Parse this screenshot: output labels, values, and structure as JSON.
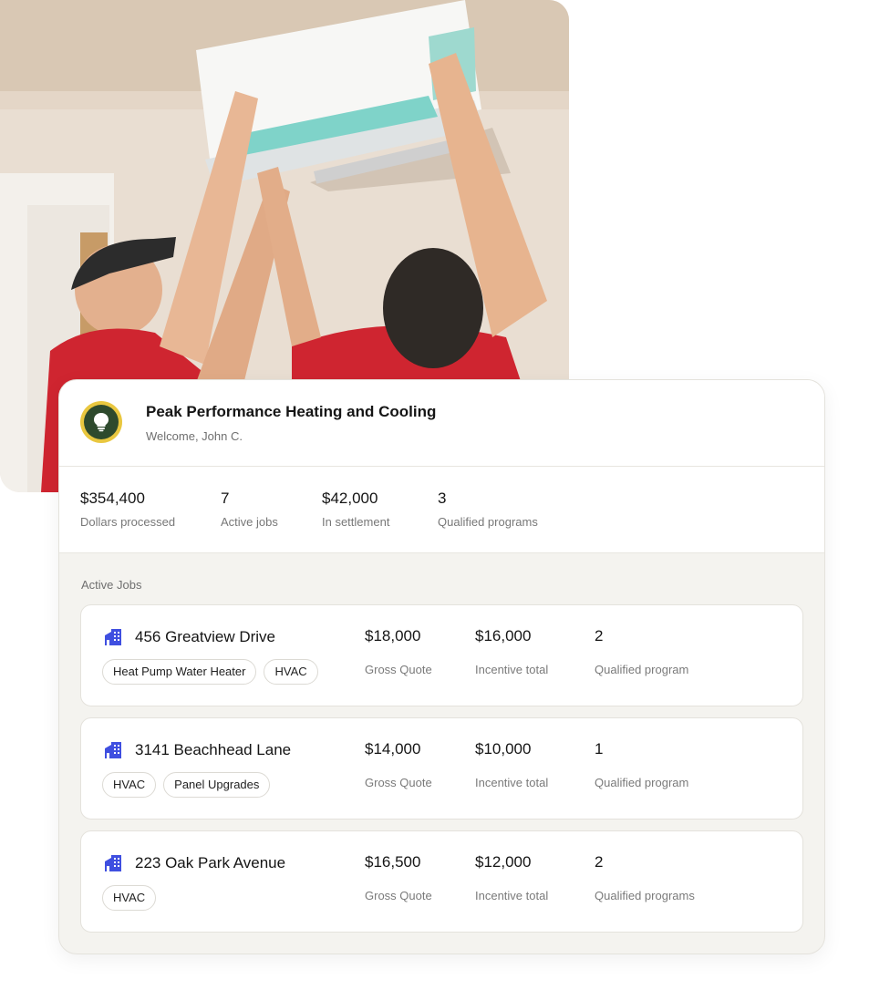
{
  "company": {
    "name": "Peak Performance Heating and Cooling",
    "welcome": "Welcome, John C.",
    "logo_icon": "lightbulb-icon"
  },
  "colors": {
    "logo_ring": "#e9c73f",
    "logo_fill": "#2e4a2d",
    "building_icon": "#3f4fe0",
    "card_background": "#f4f3ef"
  },
  "stats": [
    {
      "value": "$354,400",
      "label": "Dollars processed"
    },
    {
      "value": "7",
      "label": "Active jobs"
    },
    {
      "value": "$42,000",
      "label": "In settlement"
    },
    {
      "value": "3",
      "label": "Qualified programs"
    }
  ],
  "active_jobs": {
    "title": "Active Jobs",
    "jobs": [
      {
        "address": "456 Greatview Drive",
        "tags": [
          "Heat Pump Water Heater",
          "HVAC"
        ],
        "gross_quote": "$18,000",
        "gross_quote_label": "Gross Quote",
        "incentive_total": "$16,000",
        "incentive_label": "Incentive total",
        "programs": "2",
        "programs_label": "Qualified program"
      },
      {
        "address": "3141 Beachhead Lane",
        "tags": [
          "HVAC",
          "Panel Upgrades"
        ],
        "gross_quote": "$14,000",
        "gross_quote_label": "Gross Quote",
        "incentive_total": "$10,000",
        "incentive_label": "Incentive total",
        "programs": "1",
        "programs_label": "Qualified program"
      },
      {
        "address": "223 Oak Park Avenue",
        "tags": [
          "HVAC"
        ],
        "gross_quote": "$16,500",
        "gross_quote_label": "Gross Quote",
        "incentive_total": "$12,000",
        "incentive_label": "Incentive total",
        "programs": "2",
        "programs_label": "Qualified programs"
      }
    ]
  }
}
